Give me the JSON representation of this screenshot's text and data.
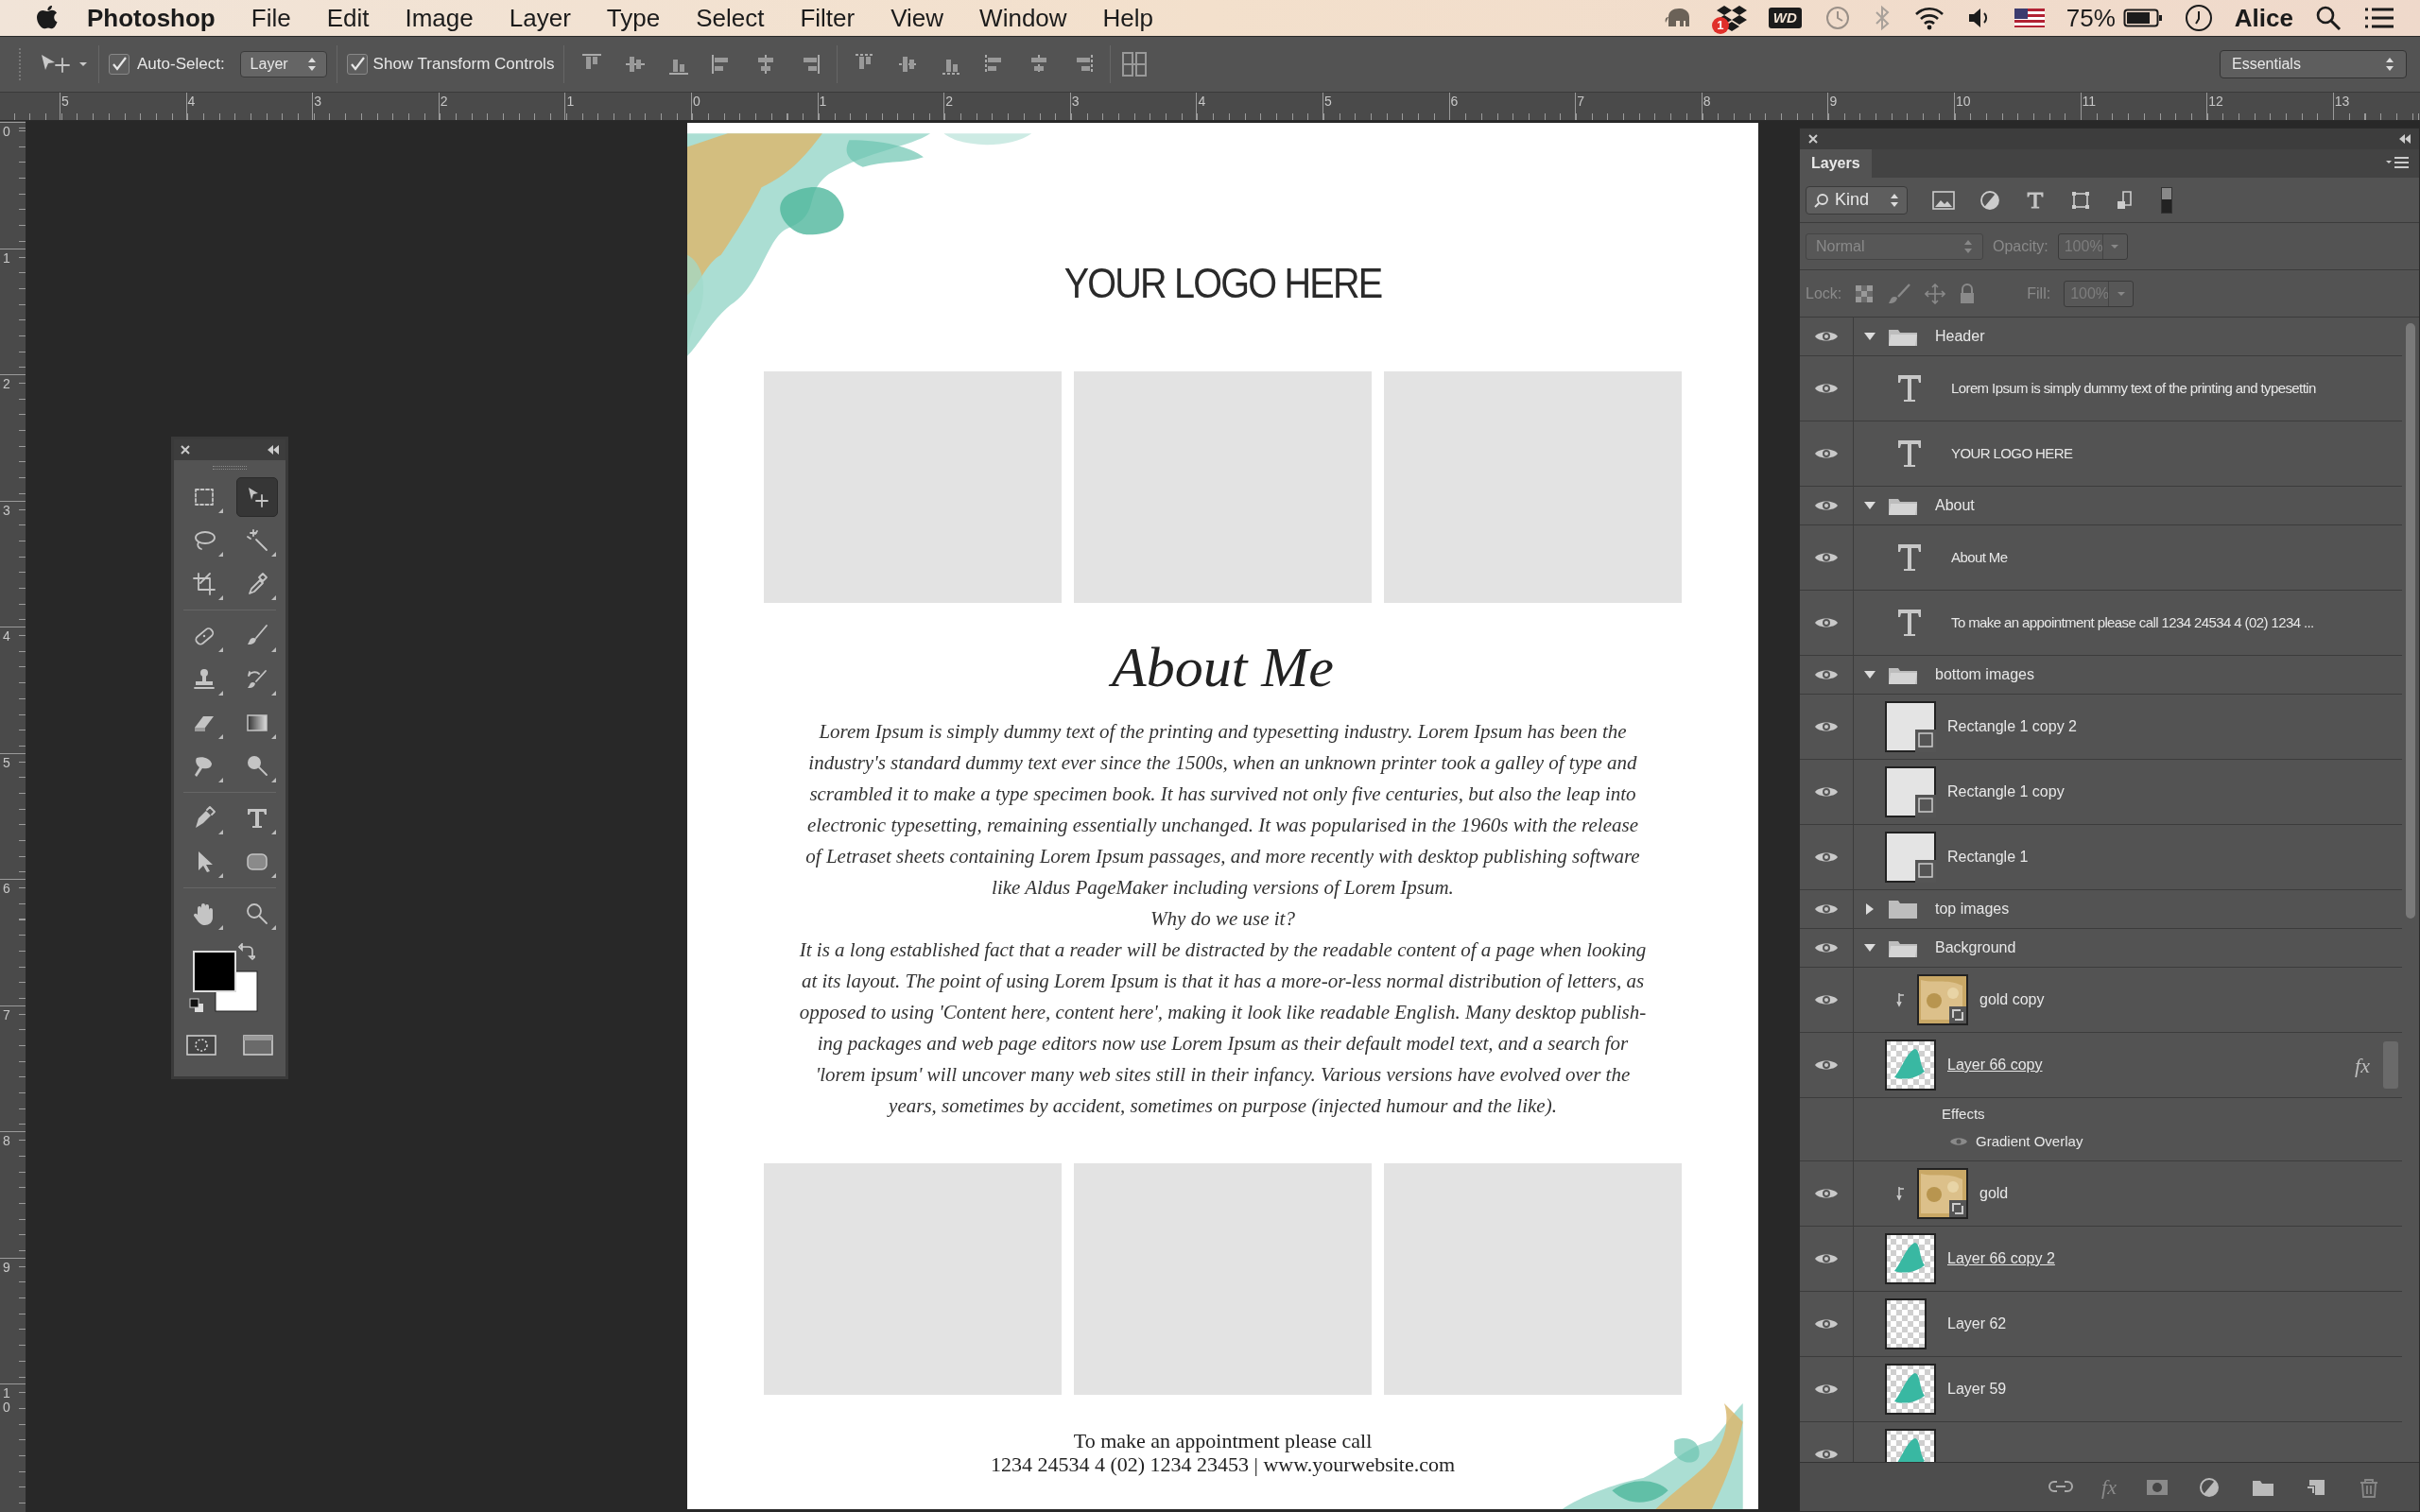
{
  "menu_bar": {
    "app": "Photoshop",
    "menus": [
      "File",
      "Edit",
      "Image",
      "Layer",
      "Type",
      "Select",
      "Filter",
      "View",
      "Window",
      "Help"
    ],
    "dropbox_badge": "1",
    "wd_label": "WD",
    "battery": "75%",
    "user": "Alice"
  },
  "options_bar": {
    "auto_select": {
      "label": "Auto-Select:",
      "checked": true
    },
    "auto_select_target": "Layer",
    "transform_controls": {
      "label": "Show Transform Controls",
      "checked": true
    },
    "workspace": "Essentials"
  },
  "rulers": {
    "horizontal": [
      "5",
      "4",
      "3",
      "2",
      "1",
      "0",
      "1",
      "2",
      "3",
      "4",
      "5",
      "6",
      "7",
      "8",
      "9",
      "10",
      "11",
      "12",
      "13"
    ],
    "vertical": [
      "0",
      "1",
      "2",
      "3",
      "4",
      "5",
      "6",
      "7",
      "8",
      "9",
      "10"
    ]
  },
  "tools": [
    {
      "kind": "marquee",
      "selected": false
    },
    {
      "kind": "move",
      "selected": true
    },
    {
      "kind": "lasso",
      "selected": false
    },
    {
      "kind": "wand",
      "selected": false
    },
    {
      "kind": "crop",
      "selected": false
    },
    {
      "kind": "eyedropper",
      "selected": false
    },
    {
      "kind": "heal",
      "selected": false
    },
    {
      "kind": "brush",
      "selected": false
    },
    {
      "kind": "stamp",
      "selected": false
    },
    {
      "kind": "history",
      "selected": false
    },
    {
      "kind": "eraser",
      "selected": false
    },
    {
      "kind": "gradient",
      "selected": false
    },
    {
      "kind": "blur",
      "selected": false
    },
    {
      "kind": "dodge",
      "selected": false
    },
    {
      "kind": "pen",
      "selected": false
    },
    {
      "kind": "type",
      "selected": false
    },
    {
      "kind": "pathselect",
      "selected": false
    },
    {
      "kind": "shape",
      "selected": false
    },
    {
      "kind": "hand",
      "selected": false
    },
    {
      "kind": "zoom",
      "selected": false
    }
  ],
  "document": {
    "logo": "YOUR LOGO HERE",
    "heading": "About Me",
    "paragraph_1": "Lorem Ipsum is simply dummy text of the printing and typesetting industry. Lorem Ipsum has been the\nindustry's standard dummy text ever since the 1500s, when an unknown printer took a galley of type and\nscrambled it to make a type specimen book. It has survived not only five centuries, but also the leap into\nelectronic typesetting, remaining essentially unchanged. It was popularised in the 1960s with the release\nof Letraset sheets containing Lorem Ipsum passages, and more recently with desktop publishing software\nlike Aldus PageMaker including versions of Lorem Ipsum.",
    "subheading": "Why do we use it?",
    "paragraph_2": "It is a long established fact that a reader will be distracted by the readable content of a page when looking\nat its layout. The point of using Lorem Ipsum is that it has a more-or-less normal distribution of letters, as\nopposed to using 'Content here, content here', making it look like readable English. Many desktop publish-\ning packages and web page editors now use Lorem Ipsum as their default model text, and a search for\n'lorem ipsum' will uncover many web sites still in their infancy. Various versions have evolved over the\nyears, sometimes by accident, sometimes on purpose (injected humour and the like).",
    "footer_lines": [
      "To make an appointment please call",
      "1234 24534 4 (02) 1234 23453 | www.yourwebsite.com"
    ]
  },
  "layers_panel": {
    "tab": "Layers",
    "filter": "Kind",
    "blend_mode": "Normal",
    "opacity_label": "Opacity:",
    "opacity": "100%",
    "lock_label": "Lock:",
    "fill_label": "Fill:",
    "fill": "100%",
    "layers": [
      {
        "kind": "group",
        "name": "Header",
        "expanded": true,
        "visible": true,
        "children": [
          {
            "kind": "text",
            "name": "Lorem Ipsum is simply dummy text of the printing and typesettin",
            "visible": true
          },
          {
            "kind": "text",
            "name": "YOUR LOGO HERE",
            "visible": true
          }
        ]
      },
      {
        "kind": "group",
        "name": "About",
        "expanded": true,
        "visible": true,
        "children": [
          {
            "kind": "text",
            "name": "About Me",
            "visible": true
          },
          {
            "kind": "text",
            "name": "To make an appointment please call 1234 24534 4 (02) 1234 ...",
            "visible": true
          }
        ]
      },
      {
        "kind": "group",
        "name": "bottom images",
        "expanded": true,
        "visible": true,
        "children": [
          {
            "kind": "shape",
            "name": "Rectangle 1 copy 2",
            "visible": true
          },
          {
            "kind": "shape",
            "name": "Rectangle 1 copy",
            "visible": true
          },
          {
            "kind": "shape",
            "name": "Rectangle 1",
            "visible": true
          }
        ]
      },
      {
        "kind": "group",
        "name": "top images",
        "expanded": false,
        "visible": true
      },
      {
        "kind": "group",
        "name": "Background",
        "expanded": true,
        "visible": true,
        "children": [
          {
            "kind": "smart",
            "name": "gold copy",
            "clipped": true,
            "visible": true
          },
          {
            "kind": "stroke",
            "name": "Layer 66 copy",
            "clip_base": true,
            "visible": true,
            "fx": "fx",
            "effects_label": "Effects",
            "effects": [
              {
                "name": "Gradient Overlay",
                "visible": true
              }
            ]
          },
          {
            "kind": "smart",
            "name": "gold",
            "clipped": true,
            "visible": true
          },
          {
            "kind": "stroke",
            "name": "Layer 66 copy 2",
            "clip_base": true,
            "visible": true
          },
          {
            "kind": "blank",
            "name": "Layer 62",
            "visible": true
          },
          {
            "kind": "stroke",
            "name": "Layer 59",
            "visible": true
          },
          {
            "kind": "stroke",
            "visible": true
          }
        ]
      }
    ],
    "bottom_bar": [
      {
        "kind": "link"
      },
      {
        "kind": "effects",
        "label": "fx"
      },
      {
        "kind": "mask"
      },
      {
        "kind": "adjustment"
      },
      {
        "kind": "folder"
      },
      {
        "kind": "new"
      },
      {
        "kind": "trash"
      }
    ]
  }
}
